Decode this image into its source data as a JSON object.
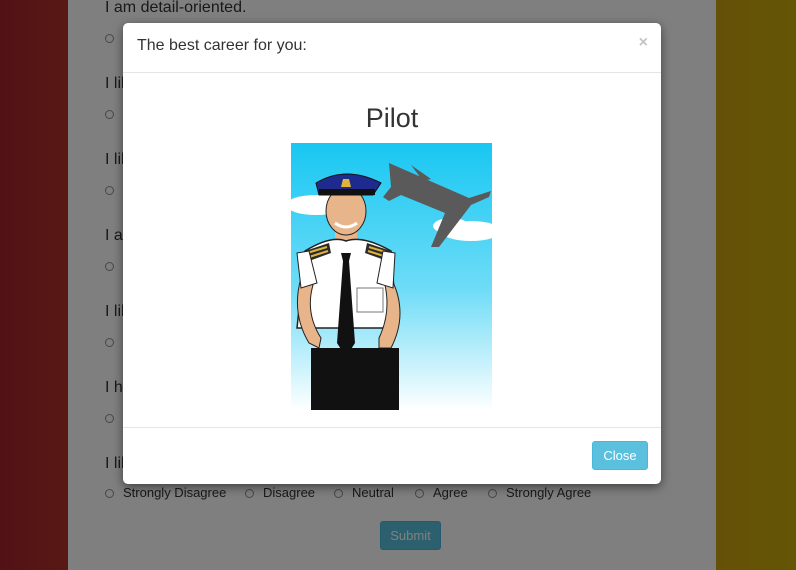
{
  "questions": [
    {
      "text": "I am detail-oriented."
    },
    {
      "text": "I lik"
    },
    {
      "text": "I lik"
    },
    {
      "text": "I a"
    },
    {
      "text": "I lik"
    },
    {
      "text": "I h"
    },
    {
      "text": "I lik"
    }
  ],
  "options": [
    "Strongly Disagree",
    "Disagree",
    "Neutral",
    "Agree",
    "Strongly Agree"
  ],
  "submit_label": "Submit",
  "modal": {
    "title": "The best career for you:",
    "close_icon": "×",
    "career": "Pilot",
    "image_icon": "pilot-illustration",
    "close_label": "Close"
  },
  "colors": {
    "accent": "#5bc0de",
    "accent_border": "#46b8da",
    "overlay": "rgba(0,0,0,0.5)"
  }
}
